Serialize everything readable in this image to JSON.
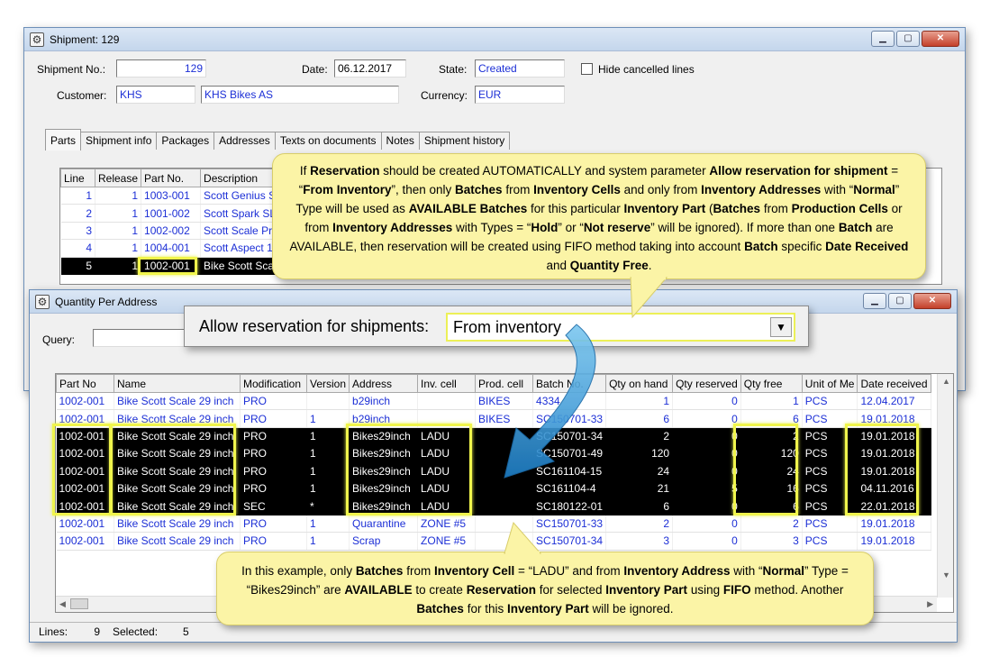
{
  "shipment_window": {
    "title": "Shipment: 129",
    "controls": {
      "minimize": "▁",
      "maximize": "▢",
      "close": "✕"
    },
    "fields": {
      "shipment_no_label": "Shipment No.:",
      "shipment_no": "129",
      "date_label": "Date:",
      "date": "06.12.2017",
      "state_label": "State:",
      "state": "Created",
      "hide_cancelled_label": "Hide cancelled lines",
      "customer_label": "Customer:",
      "customer_code": "KHS",
      "customer_name": "KHS Bikes AS",
      "currency_label": "Currency:",
      "currency": "EUR"
    },
    "tabs": [
      "Parts",
      "Shipment info",
      "Packages",
      "Addresses",
      "Texts on documents",
      "Notes",
      "Shipment history"
    ],
    "parts_table": {
      "columns": [
        "Line",
        "Release",
        "Part No.",
        "Description"
      ],
      "rows": [
        [
          "1",
          "1",
          "1003-001",
          "Scott Genius S"
        ],
        [
          "2",
          "1",
          "1001-002",
          "Scott Spark SL"
        ],
        [
          "3",
          "1",
          "1002-002",
          "Scott Scale Pr"
        ],
        [
          "4",
          "1",
          "1004-001",
          "Scott Aspect 1"
        ],
        [
          "5",
          "1",
          "1002-001",
          "Bike Scott Sca"
        ]
      ],
      "selected_row": 4
    }
  },
  "qpa_window": {
    "title": "Quantity Per Address",
    "controls": {
      "minimize": "▁",
      "maximize": "▢",
      "close": "✕"
    },
    "query_label": "Query:",
    "table": {
      "columns": [
        "Part No",
        "Name",
        "Modification",
        "Version",
        "Address",
        "Inv. cell",
        "Prod. cell",
        "Batch No.",
        "Qty on hand",
        "Qty reserved",
        "Qty free",
        "Unit of Me",
        "Date received"
      ],
      "rows": [
        [
          "1002-001",
          "Bike Scott Scale 29 inch",
          "PRO",
          "",
          "b29inch",
          "",
          "BIKES",
          "4334",
          "1",
          "0",
          "1",
          "PCS",
          "12.04.2017"
        ],
        [
          "1002-001",
          "Bike Scott Scale 29 inch",
          "PRO",
          "1",
          "b29inch",
          "",
          "BIKES",
          "SC150701-33",
          "6",
          "0",
          "6",
          "PCS",
          "19.01.2018"
        ],
        [
          "1002-001",
          "Bike Scott Scale 29 inch",
          "PRO",
          "1",
          "Bikes29inch",
          "LADU",
          "",
          "SC150701-34",
          "2",
          "0",
          "2",
          "PCS",
          "19.01.2018"
        ],
        [
          "1002-001",
          "Bike Scott Scale 29 inch",
          "PRO",
          "1",
          "Bikes29inch",
          "LADU",
          "",
          "SC150701-49",
          "120",
          "0",
          "120",
          "PCS",
          "19.01.2018"
        ],
        [
          "1002-001",
          "Bike Scott Scale 29 inch",
          "PRO",
          "1",
          "Bikes29inch",
          "LADU",
          "",
          "SC161104-15",
          "24",
          "0",
          "24",
          "PCS",
          "19.01.2018"
        ],
        [
          "1002-001",
          "Bike Scott Scale 29 inch",
          "PRO",
          "1",
          "Bikes29inch",
          "LADU",
          "",
          "SC161104-4",
          "21",
          "5",
          "16",
          "PCS",
          "04.11.2016"
        ],
        [
          "1002-001",
          "Bike Scott Scale 29 inch",
          "SEC",
          "*",
          "Bikes29inch",
          "LADU",
          "",
          "SC180122-01",
          "6",
          "0",
          "6",
          "PCS",
          "22.01.2018"
        ],
        [
          "1002-001",
          "Bike Scott Scale 29 inch",
          "PRO",
          "1",
          "Quarantine",
          "ZONE #5",
          "",
          "SC150701-33",
          "2",
          "0",
          "2",
          "PCS",
          "19.01.2018"
        ],
        [
          "1002-001",
          "Bike Scott Scale 29 inch",
          "PRO",
          "1",
          "Scrap",
          "ZONE #5",
          "",
          "SC150701-34",
          "3",
          "0",
          "3",
          "PCS",
          "19.01.2018"
        ]
      ],
      "highlighted_rows": [
        2,
        3,
        4,
        5,
        6
      ]
    },
    "status": {
      "lines_label": "Lines:",
      "lines": "9",
      "selected_label": "Selected:",
      "selected": "5"
    }
  },
  "parameter": {
    "label": "Allow reservation for shipments:",
    "value": "From inventory"
  },
  "callouts": {
    "top": [
      [
        "",
        "If "
      ],
      [
        "b",
        "Reservation"
      ],
      [
        "",
        " should be created AUTOMATICALLY and system parameter "
      ],
      [
        "b",
        "Allow reservation for shipment"
      ],
      [
        "",
        " = “"
      ],
      [
        "b",
        "From Inventory"
      ],
      [
        "",
        "”, then only "
      ],
      [
        "b",
        "Batches"
      ],
      [
        "",
        " from "
      ],
      [
        "b",
        "Inventory Cells"
      ],
      [
        "",
        " and only from "
      ],
      [
        "b",
        "Inventory Addresses"
      ],
      [
        "",
        " with “"
      ],
      [
        "b",
        "Normal"
      ],
      [
        "",
        "” Type will be used as "
      ],
      [
        "b",
        "AVAILABLE Batches"
      ],
      [
        "",
        " for this particular "
      ],
      [
        "b",
        "Inventory Part"
      ],
      [
        "",
        " ("
      ],
      [
        "b",
        "Batches"
      ],
      [
        "",
        " from "
      ],
      [
        "b",
        "Production  Cells"
      ],
      [
        "",
        " or from "
      ],
      [
        "b",
        "Inventory Addresses"
      ],
      [
        "",
        " with Types = “"
      ],
      [
        "b",
        "Hold"
      ],
      [
        "",
        "” or “"
      ],
      [
        "b",
        "Not reserve"
      ],
      [
        "",
        "” will be ignored). If more than one "
      ],
      [
        "b",
        "Batch"
      ],
      [
        "",
        " are AVAILABLE, then reservation will be created using FIFO method taking into account "
      ],
      [
        "b",
        "Batch"
      ],
      [
        "",
        " specific "
      ],
      [
        "b",
        "Date Received"
      ],
      [
        "",
        " and "
      ],
      [
        "b",
        "Quantity Free"
      ],
      [
        "",
        "."
      ]
    ],
    "bottom": [
      [
        "",
        "In this example, only "
      ],
      [
        "b",
        "Batches"
      ],
      [
        "",
        " from "
      ],
      [
        "b",
        "Inventory Cell"
      ],
      [
        "",
        " = “LADU” and from "
      ],
      [
        "b",
        "Inventory Address"
      ],
      [
        "",
        " with “"
      ],
      [
        "b",
        "Normal"
      ],
      [
        "",
        "” Type = “Bikes29inch” are "
      ],
      [
        "b",
        "AVAILABLE"
      ],
      [
        "",
        " to create "
      ],
      [
        "b",
        "Reservation"
      ],
      [
        "",
        " for selected "
      ],
      [
        "b",
        "Inventory Part"
      ],
      [
        "",
        " using "
      ],
      [
        "b",
        "FIFO"
      ],
      [
        "",
        " method.  Another "
      ],
      [
        "b",
        "Batches"
      ],
      [
        "",
        " for this "
      ],
      [
        "b",
        "Inventory Part"
      ],
      [
        "",
        " will be ignored."
      ]
    ]
  }
}
